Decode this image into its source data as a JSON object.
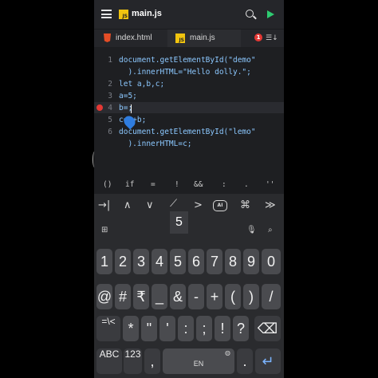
{
  "header": {
    "file_badge": "JS",
    "title": "main.js"
  },
  "tabs": [
    {
      "label": "index.html"
    },
    {
      "label": "main.js"
    }
  ],
  "error_count": "1",
  "editor": {
    "line_numbers": [
      "1",
      "2",
      "3",
      "4",
      "5",
      "6"
    ],
    "lines": [
      "document.getElementById(\"demo\"",
      "  ).innerHTML=\"Hello dolly.\";",
      "let a,b,c;",
      "a=5;",
      "b=;",
      "c=a+b;",
      "document.getElementById(\"lemo\"",
      "  ).innerHTML=c;"
    ]
  },
  "snippets": [
    "()",
    "if",
    "=",
    "!",
    "&&",
    ":",
    ".",
    "''"
  ],
  "keyboard": {
    "nav": [
      "→|",
      "∧",
      "∨",
      "⟋",
      ">",
      "AI",
      "⌘",
      "≫"
    ],
    "preview": "5",
    "numbers": [
      "1",
      "2",
      "3",
      "4",
      "5",
      "6",
      "7",
      "8",
      "9",
      "0"
    ],
    "symbols1": [
      "@",
      "#",
      "₹",
      "_",
      "&",
      "-",
      "+",
      "(",
      ")",
      "/"
    ],
    "symbols2": [
      "*",
      "\"",
      "'",
      ":",
      ";",
      "!",
      "?"
    ],
    "bottom": {
      "abc": "ABC",
      "nums": "123",
      "comma": ",",
      "space_label": "EN",
      "period": "."
    }
  },
  "colors": {
    "accent": "#2ecc71",
    "error": "#e53935",
    "js_badge": "#f1c40f",
    "code": "#8cc8ff"
  }
}
